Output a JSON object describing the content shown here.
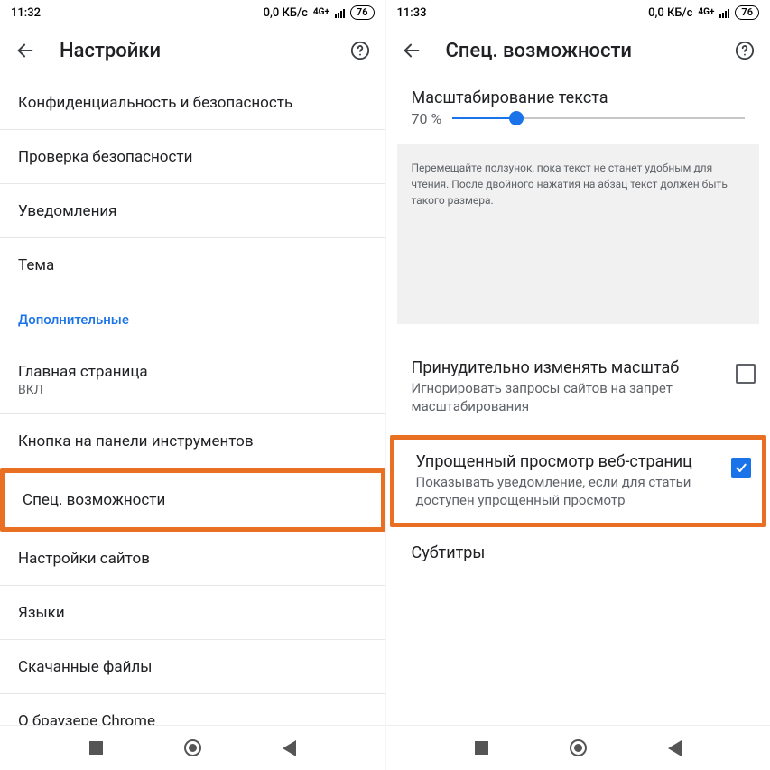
{
  "left": {
    "status": {
      "time": "11:32",
      "data_rate": "0,0 КБ/с",
      "net": "4G+",
      "battery": "76"
    },
    "title": "Настройки",
    "items": [
      {
        "title": "Конфиденциальность и безопасность"
      },
      {
        "title": "Проверка безопасности"
      },
      {
        "title": "Уведомления"
      },
      {
        "title": "Тема"
      }
    ],
    "category": "Дополнительные",
    "items2": [
      {
        "title": "Главная страница",
        "sub": "ВКЛ"
      },
      {
        "title": "Кнопка на панели инструментов"
      },
      {
        "title": "Спец. возможности",
        "highlight": true
      },
      {
        "title": "Настройки сайтов"
      },
      {
        "title": "Языки"
      },
      {
        "title": "Скачанные файлы"
      },
      {
        "title": "О браузере Chrome"
      }
    ]
  },
  "right": {
    "status": {
      "time": "11:33",
      "data_rate": "0,0 КБ/с",
      "net": "4G+",
      "battery": "76"
    },
    "title": "Спец. возможности",
    "text_scaling": {
      "label": "Масштабирование текста",
      "value": "70 %",
      "percent": 22
    },
    "preview_text": "Перемещайте ползунок, пока текст не станет удобным для чтения. После двойного нажатия на абзац текст должен быть такого размера.",
    "rows": [
      {
        "title": "Принудительно изменять масштаб",
        "sub": "Игнорировать запросы сайтов на запрет масштабирования",
        "checked": false
      },
      {
        "title": "Упрощенный просмотр веб-страниц",
        "sub": "Показывать уведомление, если для статьи доступен упрощенный просмотр",
        "checked": true,
        "highlight": true
      },
      {
        "title": "Субтитры"
      }
    ]
  }
}
